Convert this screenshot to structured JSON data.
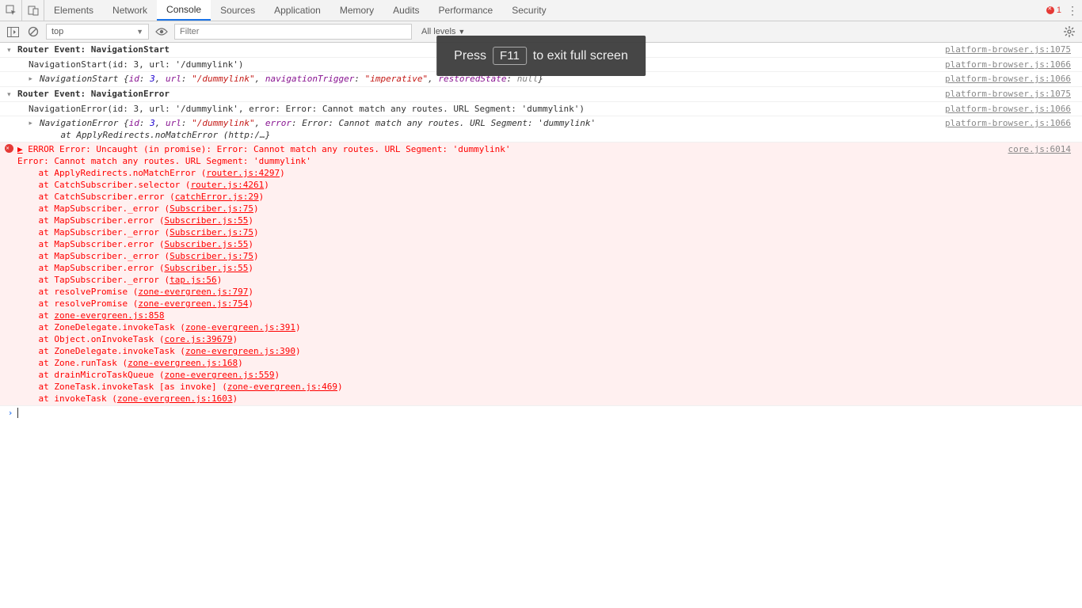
{
  "tabs": {
    "t0": "Elements",
    "t1": "Network",
    "t2": "Console",
    "t3": "Sources",
    "t4": "Application",
    "t5": "Memory",
    "t6": "Audits",
    "t7": "Performance",
    "t8": "Security"
  },
  "error_count": "1",
  "toolbar": {
    "context": "top",
    "filter_placeholder": "Filter",
    "levels": "All levels"
  },
  "toast": {
    "pre": "Press",
    "key": "F11",
    "post": "to exit full screen"
  },
  "src": {
    "pb1075": "platform-browser.js:1075",
    "pb1066": "platform-browser.js:1066",
    "core": "core.js:6014"
  },
  "log": {
    "g1": "Router Event: NavigationStart",
    "l1": "NavigationStart(id: 3, url: '/dummylink')",
    "o1": {
      "pre": "NavigationStart {",
      "id_k": "id",
      "id_v": "3",
      "url_k": "url",
      "url_v": "\"/dummylink\"",
      "nt_k": "navigationTrigger",
      "nt_v": "\"imperative\"",
      "rs_k": "restoredState",
      "rs_v": "null",
      "post": "}"
    },
    "g2": "Router Event: NavigationError",
    "l2": "NavigationError(id: 3, url: '/dummylink', error: Error: Cannot match any routes. URL Segment: 'dummylink')",
    "o2": {
      "pre": "NavigationError {",
      "id_k": "id",
      "id_v": "3",
      "url_k": "url",
      "url_v": "\"/dummylink\"",
      "er_k": "error",
      "er_v": "Error: Cannot match any routes. URL Segment: 'dummylink'",
      "tail": "    at ApplyRedirects.noMatchError (http:/…}"
    }
  },
  "error": {
    "head": "ERROR Error: Uncaught (in promise): Error: Cannot match any routes. URL Segment: 'dummylink'",
    "sub": "Error: Cannot match any routes. URL Segment: 'dummylink'",
    "stack": [
      {
        "fn": "ApplyRedirects.noMatchError",
        "loc": "router.js:4297"
      },
      {
        "fn": "CatchSubscriber.selector",
        "loc": "router.js:4261"
      },
      {
        "fn": "CatchSubscriber.error",
        "loc": "catchError.js:29"
      },
      {
        "fn": "MapSubscriber._error",
        "loc": "Subscriber.js:75"
      },
      {
        "fn": "MapSubscriber.error",
        "loc": "Subscriber.js:55"
      },
      {
        "fn": "MapSubscriber._error",
        "loc": "Subscriber.js:75"
      },
      {
        "fn": "MapSubscriber.error",
        "loc": "Subscriber.js:55"
      },
      {
        "fn": "MapSubscriber._error",
        "loc": "Subscriber.js:75"
      },
      {
        "fn": "MapSubscriber.error",
        "loc": "Subscriber.js:55"
      },
      {
        "fn": "TapSubscriber._error",
        "loc": "tap.js:56"
      },
      {
        "fn": "resolvePromise",
        "loc": "zone-evergreen.js:797"
      },
      {
        "fn": "resolvePromise",
        "loc": "zone-evergreen.js:754"
      },
      {
        "fn": "",
        "loc": "zone-evergreen.js:858"
      },
      {
        "fn": "ZoneDelegate.invokeTask",
        "loc": "zone-evergreen.js:391"
      },
      {
        "fn": "Object.onInvokeTask",
        "loc": "core.js:39679"
      },
      {
        "fn": "ZoneDelegate.invokeTask",
        "loc": "zone-evergreen.js:390"
      },
      {
        "fn": "Zone.runTask",
        "loc": "zone-evergreen.js:168"
      },
      {
        "fn": "drainMicroTaskQueue",
        "loc": "zone-evergreen.js:559"
      },
      {
        "fn": "ZoneTask.invokeTask [as invoke]",
        "loc": "zone-evergreen.js:469"
      },
      {
        "fn": "invokeTask",
        "loc": "zone-evergreen.js:1603"
      }
    ]
  }
}
